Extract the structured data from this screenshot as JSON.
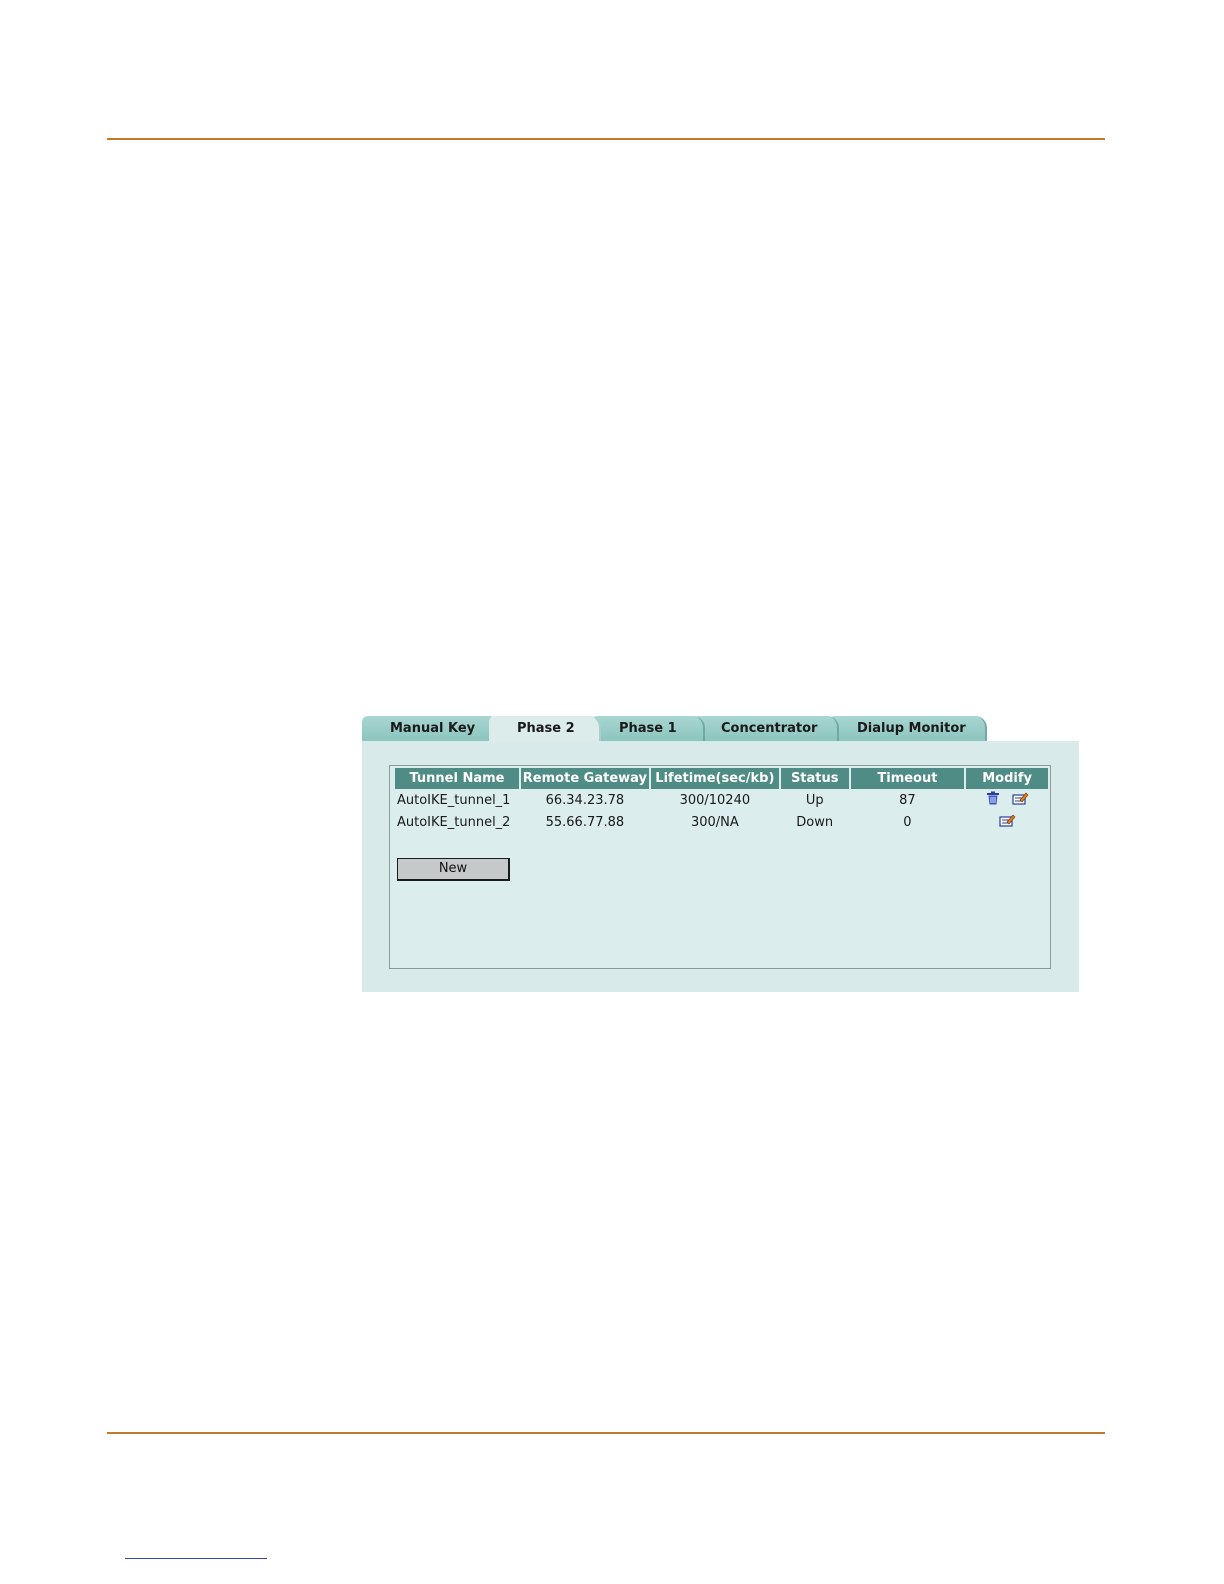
{
  "tabs": [
    {
      "label": "Manual Key",
      "active": false
    },
    {
      "label": "Phase 2",
      "active": true
    },
    {
      "label": "Phase 1",
      "active": false
    },
    {
      "label": "Concentrator",
      "active": false
    },
    {
      "label": "Dialup Monitor",
      "active": false
    }
  ],
  "table": {
    "headers": [
      "Tunnel Name",
      "Remote Gateway",
      "Lifetime(sec/kb)",
      "Status",
      "Timeout",
      "Modify"
    ],
    "rows": [
      {
        "name": "AutoIKE_tunnel_1",
        "gateway": "66.34.23.78",
        "lifetime": "300/10240",
        "status": "Up",
        "timeout": "87",
        "actions": [
          "delete-icon",
          "edit-icon"
        ]
      },
      {
        "name": "AutoIKE_tunnel_2",
        "gateway": "55.66.77.88",
        "lifetime": "300/NA",
        "status": "Down",
        "timeout": "0",
        "actions": [
          "edit-icon"
        ]
      }
    ]
  },
  "buttons": {
    "new_label": "New"
  },
  "colors": {
    "rule": "#c07a2a",
    "header_bg": "#4f8c85",
    "panel_bg": "#d8ebea",
    "tab_bg": "#a9d6d1"
  }
}
